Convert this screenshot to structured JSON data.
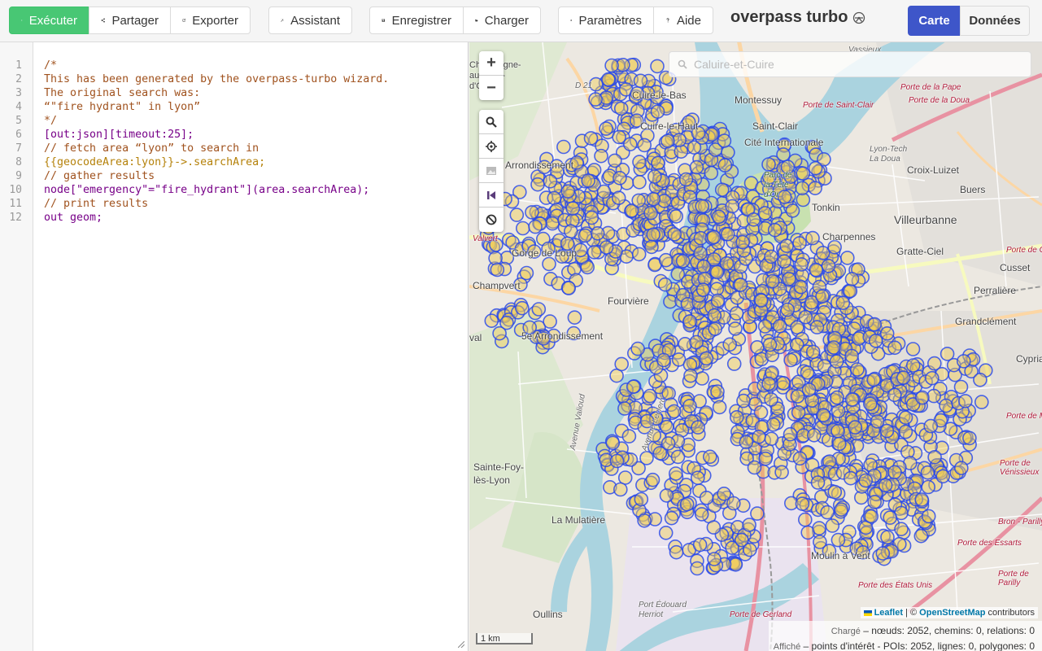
{
  "toolbar": {
    "run": "Exécuter",
    "share": "Partager",
    "export": "Exporter",
    "wizard": "Assistant",
    "save": "Enregistrer",
    "load": "Charger",
    "settings": "Paramètres",
    "help": "Aide"
  },
  "app_title": "overpass turbo",
  "tabs": {
    "map": "Carte",
    "data": "Données"
  },
  "editor": {
    "line_numbers": [
      "1",
      "2",
      "3",
      "4",
      "5",
      "6",
      "7",
      "8",
      "9",
      "10",
      "11",
      "12"
    ],
    "lines": [
      "/*",
      "This has been generated by the overpass-turbo wizard.",
      "The original search was:",
      "“\"fire hydrant\" in lyon”",
      "*/",
      "[out:json][timeout:25];",
      "// fetch area “lyon” to search in",
      "{{geocodeArea:lyon}}->.searchArea;",
      "// gather results",
      "node[\"emergency\"=\"fire_hydrant\"](area.searchArea);",
      "// print results",
      "out geom;"
    ]
  },
  "map": {
    "search_placeholder": "Caluire-et-Cuire",
    "zoom_in": "+",
    "zoom_out": "−",
    "scale": "1 km",
    "attribution_leaflet": "Leaflet",
    "attribution_sep": " | © ",
    "attribution_osm": "OpenStreetMap",
    "attribution_suffix": " contributors",
    "labels": {
      "vassieux": "Vassieux",
      "champagne": "Champagne-au-Mont-d'Or",
      "cuire_le_bas": "Cuire-le-Bas",
      "montessuy": "Montessuy",
      "porte_st_clair": "Porte de Saint-Clair",
      "porte_papa": "Porte de la Pape",
      "porte_doua": "Porte de la Doua",
      "cuire_le_haut": "Cuire-le-Haut",
      "saint_clair": "Saint-Clair",
      "cite_inter": "Cité Internationale",
      "lyon_tech": "Lyon-Tech La Doua",
      "croix_luizet": "Croix-Luizet",
      "arrondissement9": "Arrondissement",
      "parc_tete": "Parc de la Tête d'Or",
      "buers": "Buers",
      "tonkin": "Tonkin",
      "villeurbanne": "Villeurbanne",
      "charpennes": "Charpennes",
      "gratte_ciel": "Gratte-Ciel",
      "cusset": "Cusset",
      "gorge_de_loup": "Gorge de Loup",
      "champvert": "Champvert",
      "perrache_lbl": "Perralière",
      "fourviere": "Fourvière",
      "arr5": "5e Arrondissement",
      "grandclement": "Grandclément",
      "cyprian": "Cyprian",
      "sainte_foy": "Sainte-Foy-lès-Lyon",
      "la_mulatiere": "La Mulatière",
      "moulin_vent": "Moulin à Vent",
      "oullins": "Oullins",
      "port_edouard": "Port Édouard Herriot",
      "porte_gerland": "Porte de Gerland",
      "porte_etats": "Porte des États Unis",
      "porte_essarts": "Porte des Essarts",
      "porte_parilly": "Porte de Parilly",
      "porte_venissieux": "Porte de Vénissieux",
      "bron_parilly": "Bron - Parilly",
      "porte_cusset": "Porte de Cusset",
      "porte_montchat": "Porte de Montchat",
      "d21": "D 21",
      "valvert": "Valvert",
      "val": "val",
      "avenue_leclerc": "Avenue Leclerc",
      "avenue_valioud": "Avenue Valioud"
    }
  },
  "stats": {
    "loaded_label": "Chargé",
    "loaded_text": " – nœuds: 2052, chemins: 0, relations: 0",
    "shown_label": "Affiché",
    "shown_text": " – points d'intérêt - POIs: 2052, lignes: 0, polygones: 0"
  },
  "colors": {
    "run_green": "#48c774",
    "tab_blue": "#3e56c9",
    "marker_stroke": "#2244ee",
    "marker_fill": "#f0cc55"
  }
}
